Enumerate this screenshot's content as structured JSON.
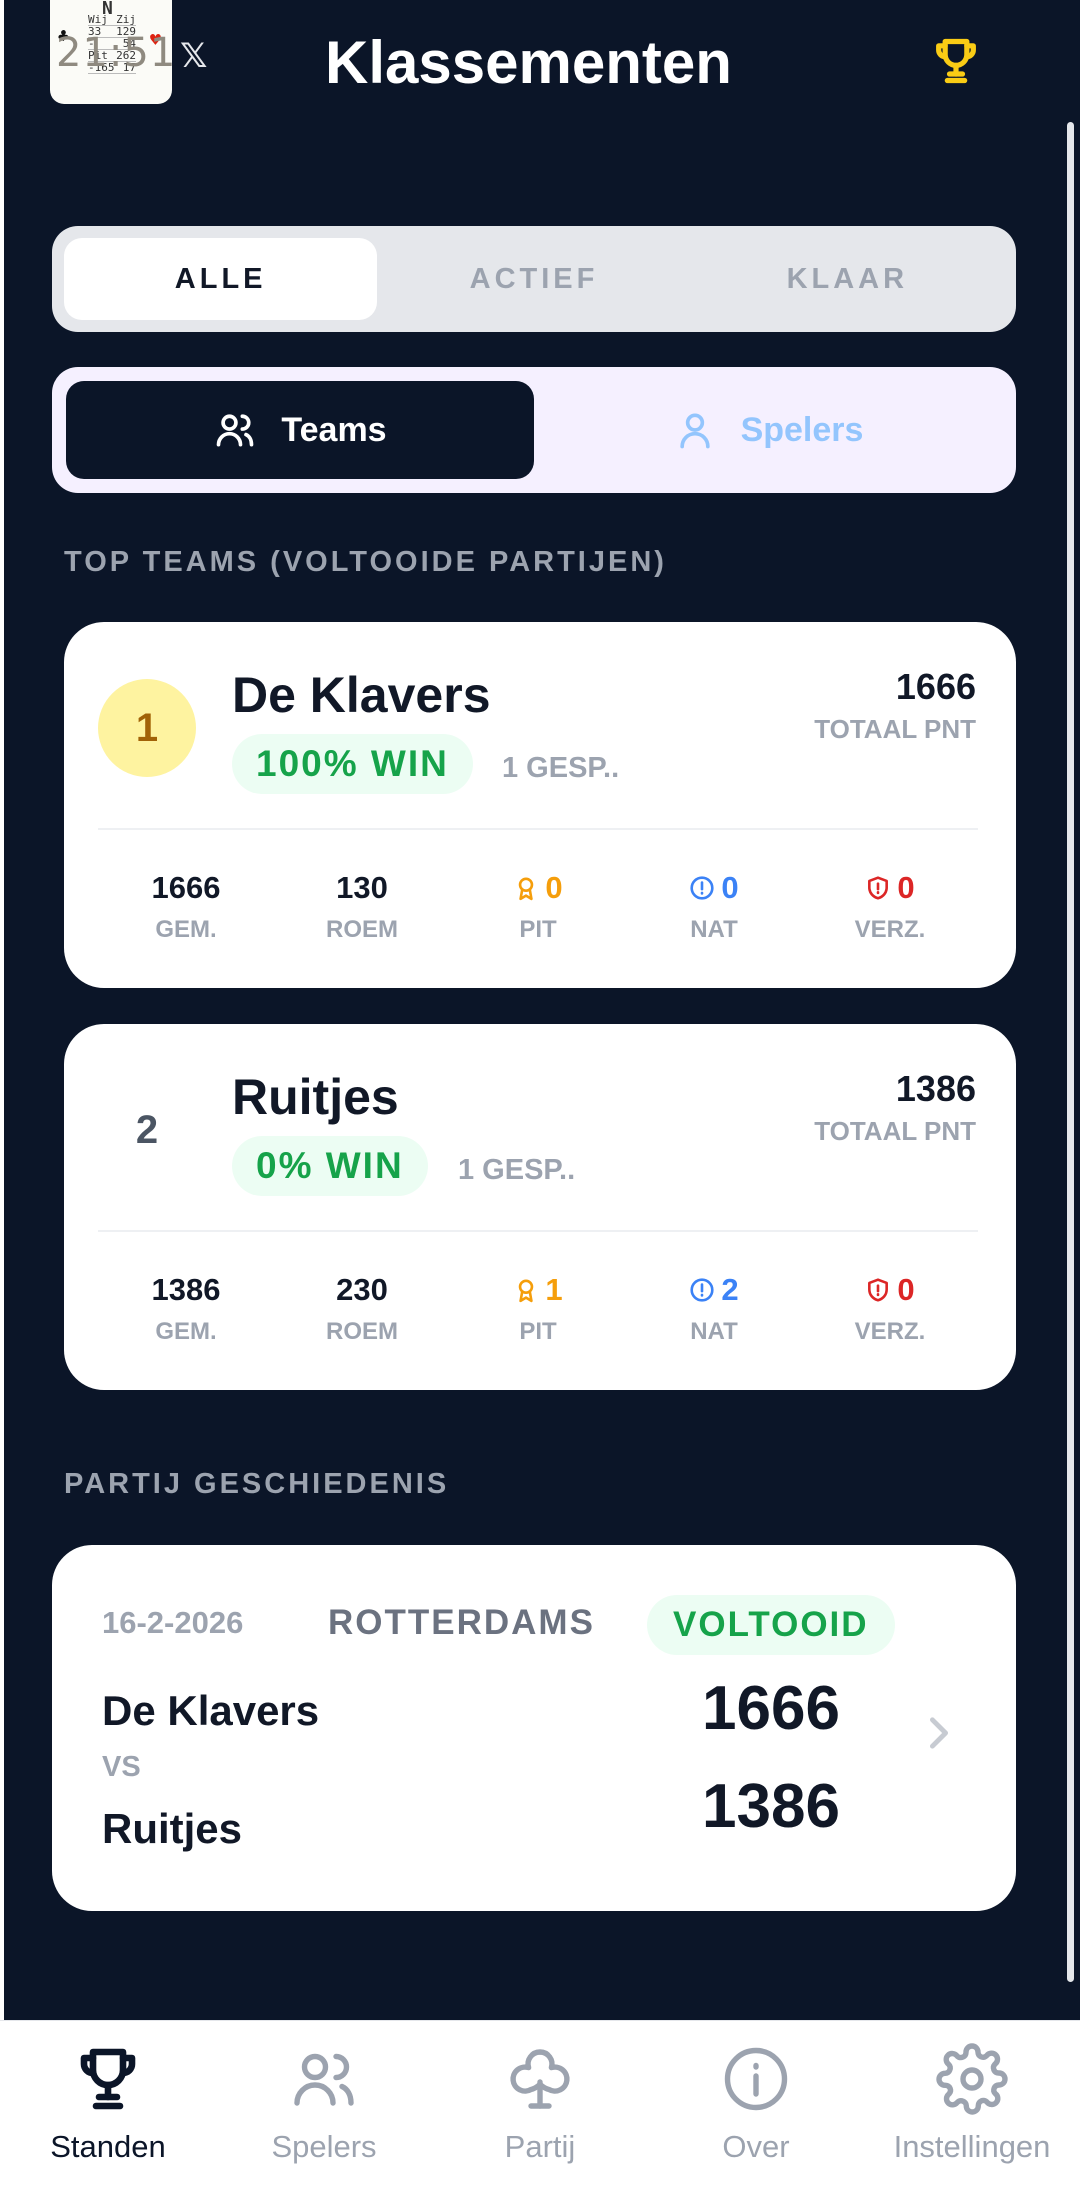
{
  "status_bar": {
    "time": "21:51",
    "left_icons": [
      "photo-icon",
      "x-icon",
      "b-icon"
    ],
    "right_icons": [
      "wifi-icon",
      "signal-icon",
      "battery-icon"
    ]
  },
  "header": {
    "title": "Klassementen",
    "app_icon": "klaverjas-scorecard-icon",
    "right_icon": "trophy-icon"
  },
  "filter_tabs": [
    {
      "label": "ALLE",
      "active": true
    },
    {
      "label": "ACTIEF",
      "active": false
    },
    {
      "label": "KLAAR",
      "active": false
    }
  ],
  "view_toggle": [
    {
      "label": "Teams",
      "icon": "users-icon",
      "active": true
    },
    {
      "label": "Spelers",
      "icon": "user-icon",
      "active": false
    }
  ],
  "top_teams": {
    "heading": "TOP TEAMS (VOLTOOIDE PARTIJEN)",
    "teams": [
      {
        "rank": "1",
        "name": "De Klavers",
        "win": "100% WIN",
        "played": "1 GESP..",
        "total_value": "1666",
        "total_label": "TOTAAL PNT",
        "stats": [
          {
            "value": "1666",
            "label": "GEM."
          },
          {
            "value": "130",
            "label": "ROEM"
          },
          {
            "value": "0",
            "label": "PIT"
          },
          {
            "value": "0",
            "label": "NAT"
          },
          {
            "value": "0",
            "label": "VERZ."
          }
        ]
      },
      {
        "rank": "2",
        "name": "Ruitjes",
        "win": "0% WIN",
        "played": "1 GESP..",
        "total_value": "1386",
        "total_label": "TOTAAL PNT",
        "stats": [
          {
            "value": "1386",
            "label": "GEM."
          },
          {
            "value": "230",
            "label": "ROEM"
          },
          {
            "value": "1",
            "label": "PIT"
          },
          {
            "value": "2",
            "label": "NAT"
          },
          {
            "value": "0",
            "label": "VERZ."
          }
        ]
      }
    ]
  },
  "history": {
    "heading": "PARTIJ GESCHIEDENIS",
    "games": [
      {
        "date": "16-2-2026",
        "type": "ROTTERDAMS",
        "status": "VOLTOOID",
        "team1": "De Klavers",
        "vs": "VS",
        "team2": "Ruitjes",
        "score1": "1666",
        "score2": "1386"
      }
    ]
  },
  "bottom_nav": [
    {
      "label": "Standen",
      "icon": "trophy-icon",
      "active": true
    },
    {
      "label": "Spelers",
      "icon": "users-icon",
      "active": false
    },
    {
      "label": "Partij",
      "icon": "club-icon",
      "active": false
    },
    {
      "label": "Over",
      "icon": "info-icon",
      "active": false
    },
    {
      "label": "Instellingen",
      "icon": "gear-icon",
      "active": false
    }
  ],
  "colors": {
    "background": "#0b1528",
    "win_green": "#16a34a",
    "gold": "#fef3a0",
    "pit_amber": "#f59e0b",
    "nat_blue": "#3b82f6",
    "verz_red": "#dc2626"
  }
}
